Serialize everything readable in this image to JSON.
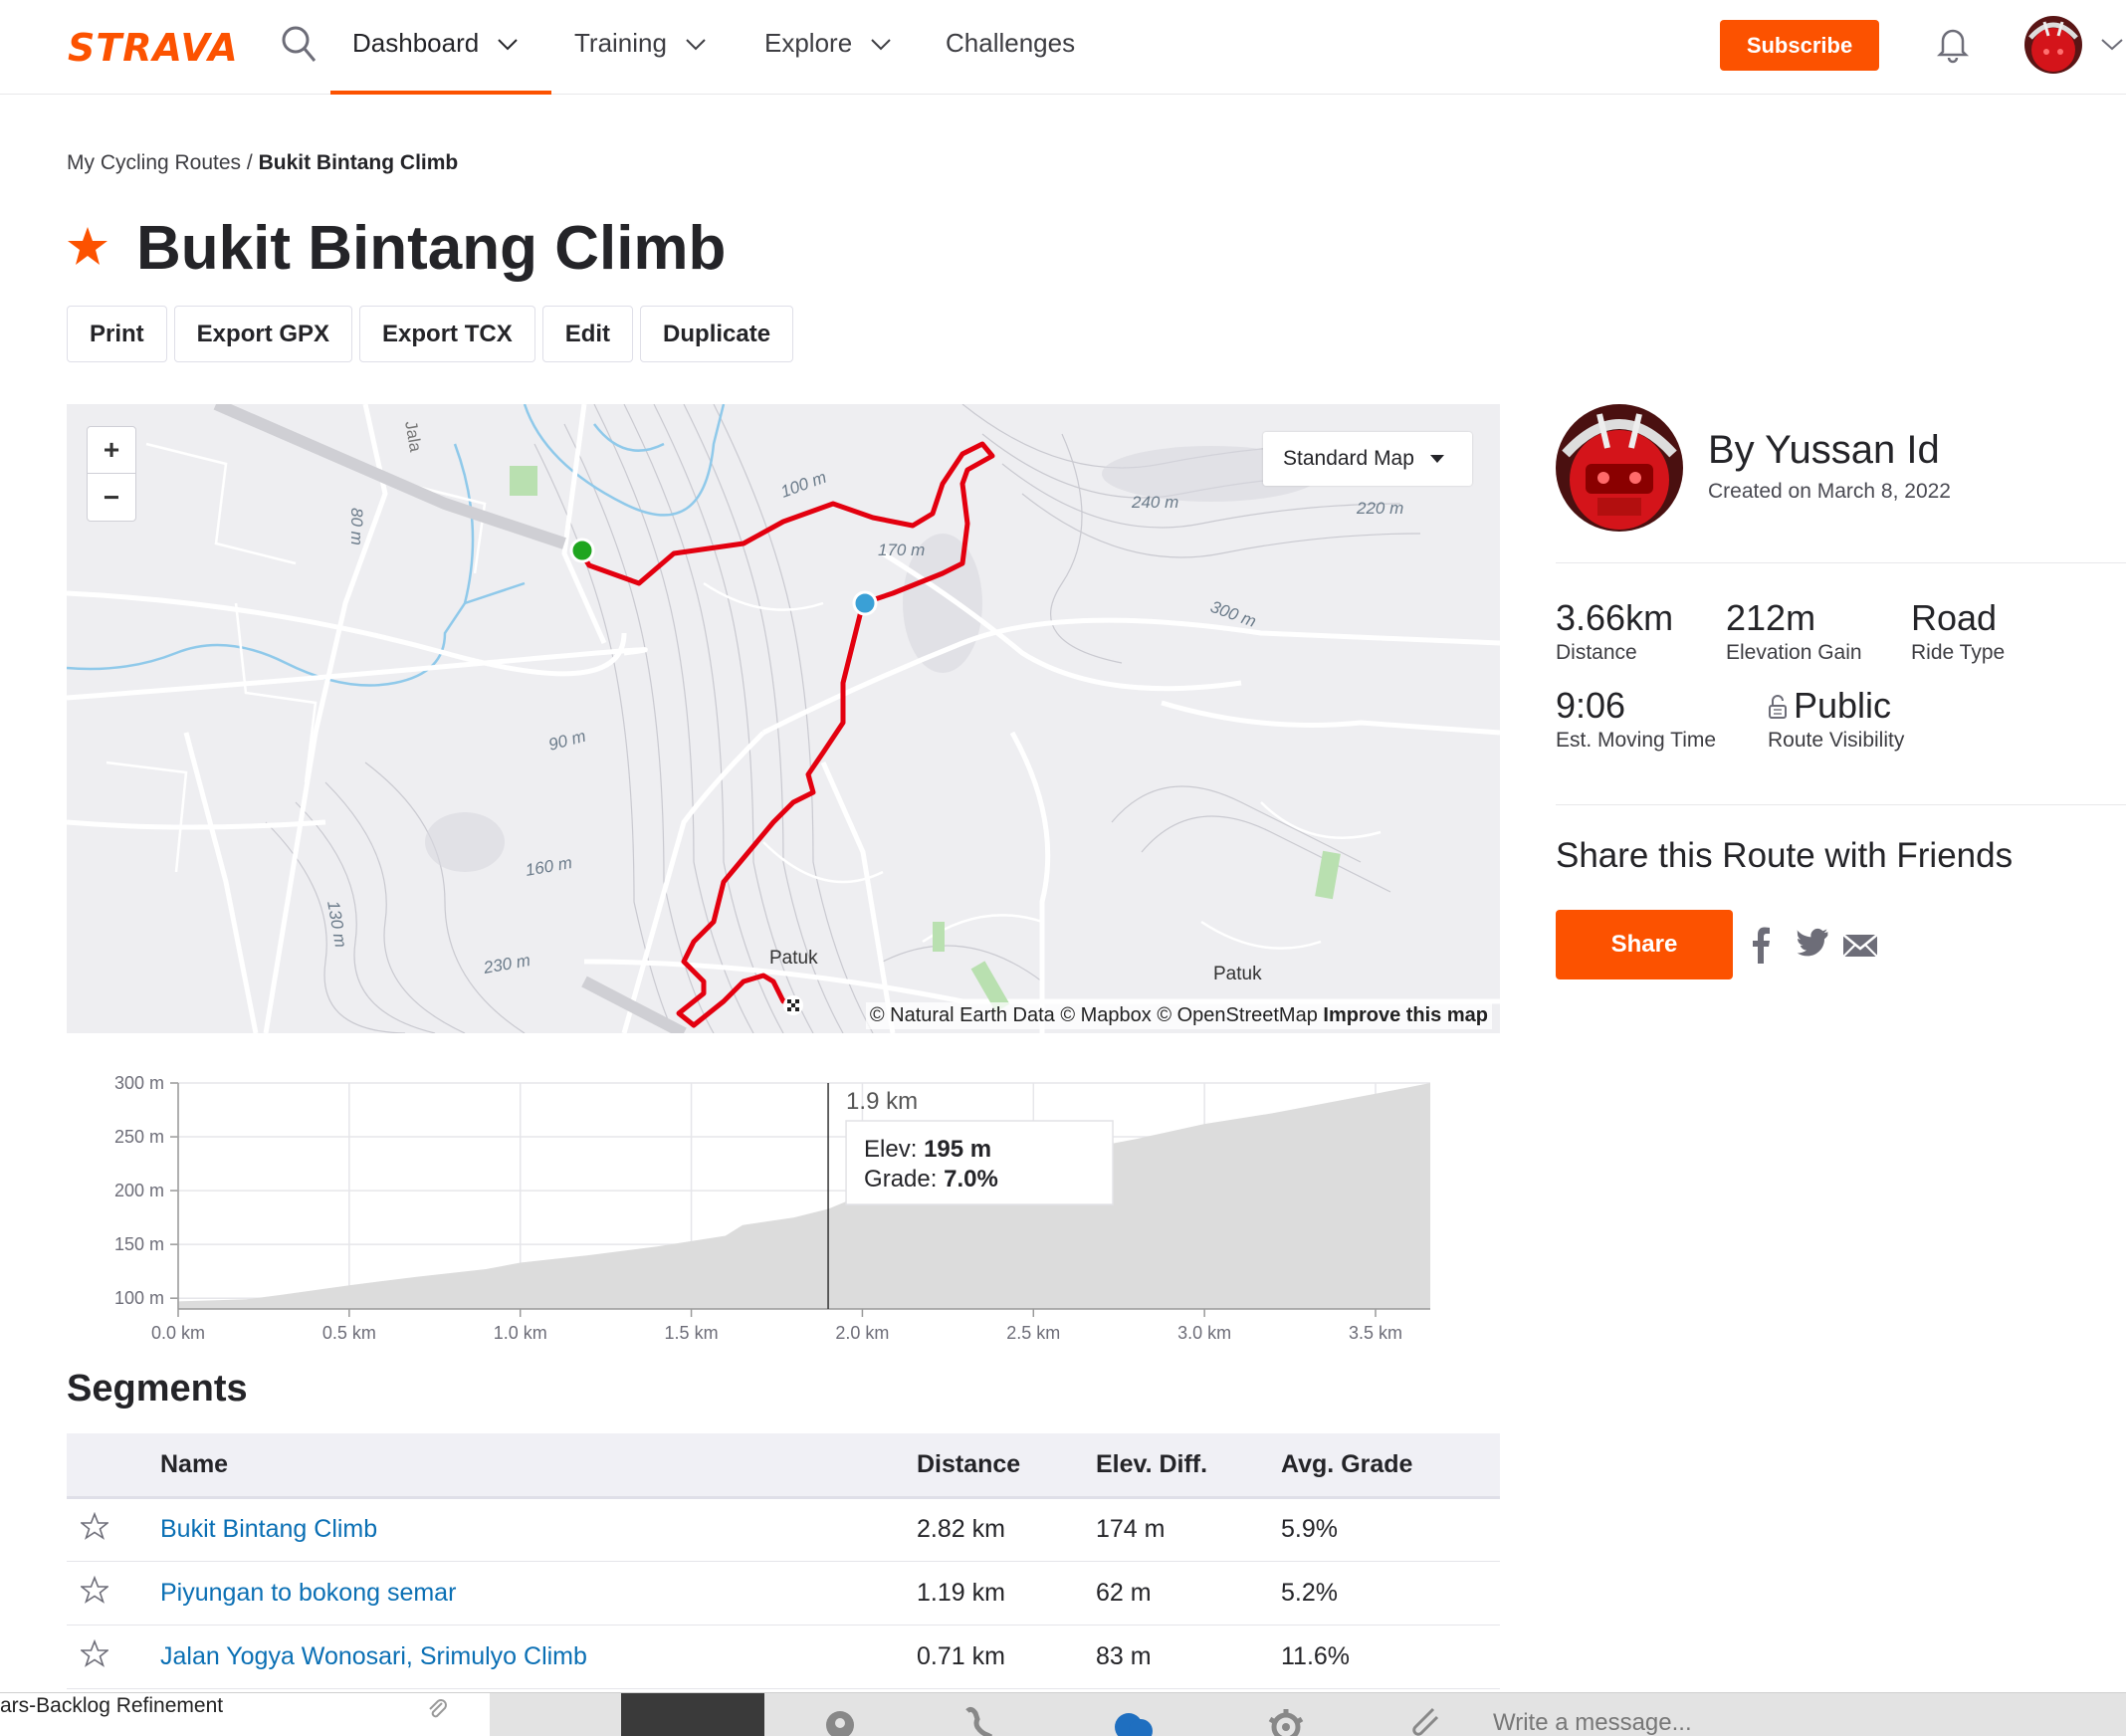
{
  "nav": {
    "logo": "STRAVA",
    "items": [
      {
        "label": "Dashboard"
      },
      {
        "label": "Training"
      },
      {
        "label": "Explore"
      },
      {
        "label": "Challenges"
      }
    ],
    "subscribe_label": "Subscribe"
  },
  "breadcrumb": {
    "parent": "My Cycling Routes",
    "separator": "/",
    "current": "Bukit Bintang Climb"
  },
  "route": {
    "title": "Bukit Bintang Climb",
    "actions": [
      "Print",
      "Export GPX",
      "Export TCX",
      "Edit",
      "Duplicate"
    ]
  },
  "map": {
    "zoom_in": "+",
    "zoom_out": "−",
    "type_label": "Standard Map",
    "attribution": "© Natural Earth Data © Mapbox © OpenStreetMap",
    "improve_label": "Improve this map",
    "labels": [
      "100 m",
      "170 m",
      "240 m",
      "220 m",
      "300 m",
      "80 m",
      "90 m",
      "160 m",
      "130 m",
      "230 m",
      "Patuk",
      "Patuk",
      "Jala"
    ]
  },
  "elevation_chart": {
    "chart_data": {
      "type": "area",
      "x_unit": "km",
      "y_unit": "m",
      "xlim": [
        0,
        3.66
      ],
      "ylim": [
        90,
        300
      ],
      "x_ticks": [
        "0.0 km",
        "0.5 km",
        "1.0 km",
        "1.5 km",
        "2.0 km",
        "2.5 km",
        "3.0 km",
        "3.5 km"
      ],
      "y_ticks": [
        "300 m",
        "250 m",
        "200 m",
        "150 m",
        "100 m"
      ],
      "series": [
        {
          "x": [
            0,
            0.1,
            0.2,
            0.3,
            0.5,
            0.7,
            0.9,
            1.0,
            1.2,
            1.4,
            1.6,
            1.65,
            1.8,
            1.9,
            2.0,
            2.2,
            2.4,
            2.6,
            2.8,
            3.0,
            3.2,
            3.4,
            3.5,
            3.66
          ],
          "y": [
            97,
            98,
            99,
            103,
            112,
            120,
            127,
            133,
            140,
            148,
            158,
            168,
            175,
            183,
            196,
            210,
            222,
            236,
            248,
            262,
            272,
            284,
            290,
            300
          ]
        }
      ],
      "cursor": {
        "x": 1.9,
        "label": "1.9 km",
        "elev_label": "Elev:",
        "elev_value": "195 m",
        "grade_label": "Grade:",
        "grade_value": "7.0%"
      },
      "color": "#dcdcdc"
    }
  },
  "segments": {
    "title": "Segments",
    "columns": [
      "Name",
      "Distance",
      "Elev. Diff.",
      "Avg. Grade"
    ],
    "rows": [
      {
        "name": "Bukit Bintang Climb",
        "distance": "2.82 km",
        "elev": "174 m",
        "grade": "5.9%"
      },
      {
        "name": "Piyungan to bokong semar",
        "distance": "1.19 km",
        "elev": "62 m",
        "grade": "5.2%"
      },
      {
        "name": "Jalan Yogya Wonosari, Srimulyo Climb",
        "distance": "0.71 km",
        "elev": "83 m",
        "grade": "11.6%"
      }
    ]
  },
  "author": {
    "name": "By Yussan Id",
    "created": "Created on March 8, 2022"
  },
  "stats": {
    "distance": {
      "value": "3.66km",
      "label": "Distance"
    },
    "elevation": {
      "value": "212m",
      "label": "Elevation Gain"
    },
    "type": {
      "value": "Road",
      "label": "Ride Type"
    },
    "time": {
      "value": "9:06",
      "label": "Est. Moving Time"
    },
    "visibility": {
      "value": "Public",
      "label": "Route Visibility"
    }
  },
  "share": {
    "title": "Share this Route with Friends",
    "button": "Share",
    "icons": [
      "facebook-icon",
      "twitter-icon",
      "email-icon"
    ]
  },
  "bottom_bar": {
    "left_text": "ars-Backlog Refinement",
    "message_placeholder": "Write a message..."
  },
  "colors": {
    "brand": "#fc5200",
    "link": "#0a6fb4",
    "route": "#e3000f",
    "start": "#1fa51f",
    "cursor_dot": "#3aa0d6"
  }
}
